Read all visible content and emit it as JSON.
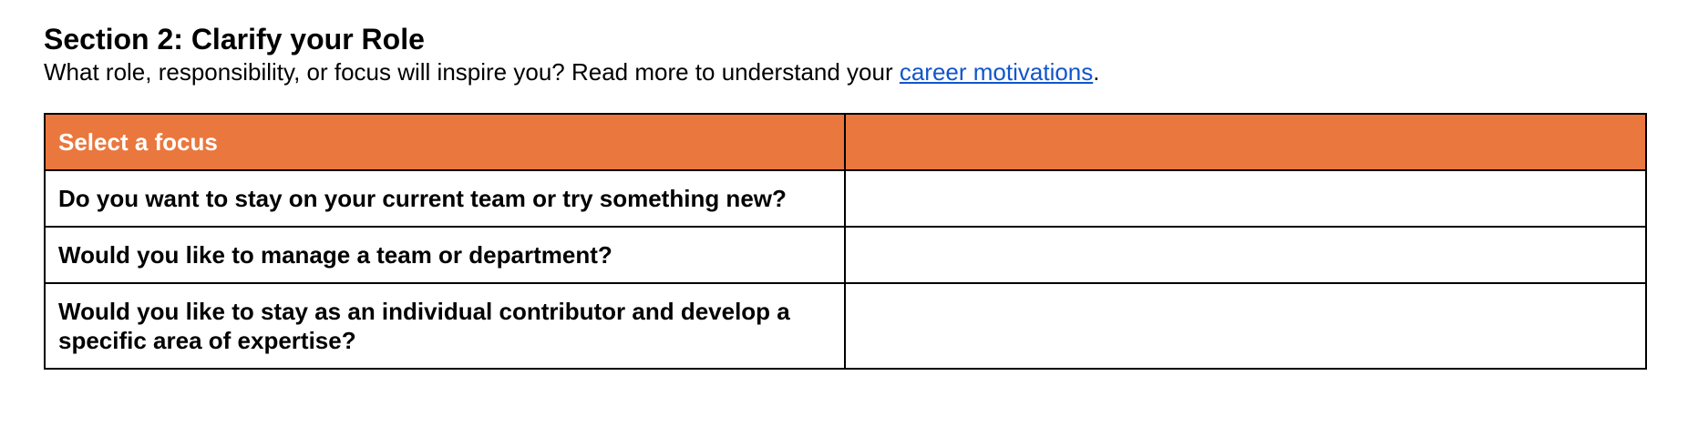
{
  "section": {
    "title": "Section 2: Clarify your Role",
    "intro_text": "What role, responsibility, or focus will inspire you? Read more to understand your ",
    "intro_link": "career motivations",
    "intro_end": "."
  },
  "table": {
    "header": [
      "Select a focus",
      ""
    ],
    "rows": [
      {
        "question": "Do you want to stay on your current team or try something new?",
        "answer": ""
      },
      {
        "question": "Would you like to manage a team or department?",
        "answer": ""
      },
      {
        "question": "Would you like to stay as an individual contributor and develop a specific area of expertise?",
        "answer": ""
      }
    ]
  },
  "colors": {
    "header_bg": "#ea773d",
    "link": "#1155cc"
  }
}
